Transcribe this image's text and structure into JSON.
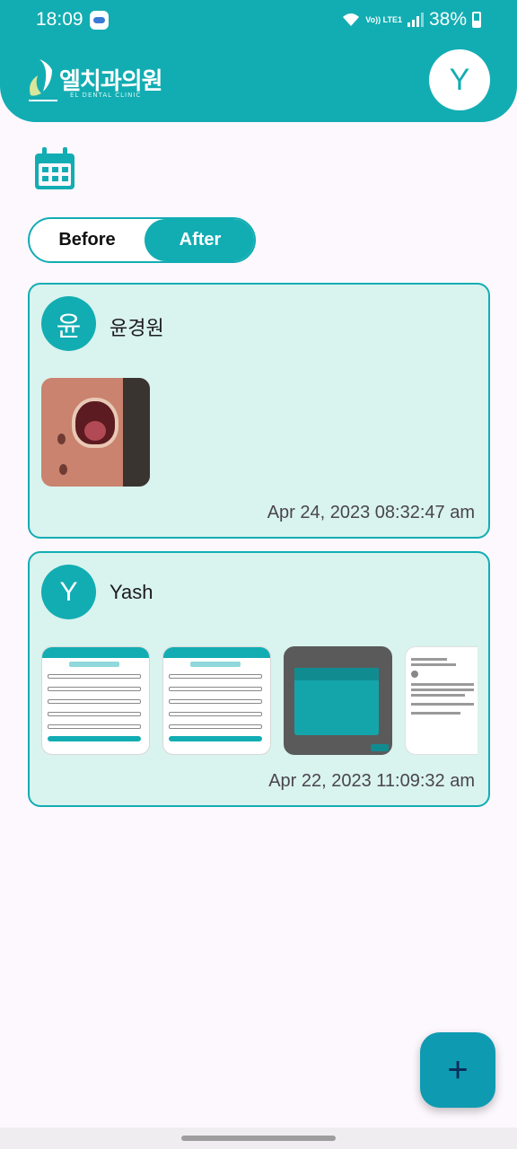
{
  "status_bar": {
    "time": "18:09",
    "network": "Vo)) LTE1",
    "battery": "38%"
  },
  "header": {
    "logo_text": "엘치과의원",
    "logo_subtitle": "EL DENTAL CLINIC",
    "profile_initial": "Y"
  },
  "filter": {
    "before_label": "Before",
    "after_label": "After",
    "selected": "After"
  },
  "cards": [
    {
      "initial": "윤",
      "name": "윤경원",
      "date": "Apr 24, 2023 08:32:47 am",
      "images": [
        "dental-photo"
      ]
    },
    {
      "initial": "Y",
      "name": "Yash",
      "date": "Apr 22, 2023 11:09:32 am",
      "images": [
        "signup-screenshot",
        "signup-screenshot",
        "date-picker-screenshot",
        "sign-in-screenshot"
      ]
    }
  ],
  "fab": {
    "label": "+"
  },
  "colors": {
    "primary": "#12adb3",
    "card_background": "#d9f3ee",
    "fab": "#0e9bb2",
    "background": "#fdf8fd"
  },
  "icons": [
    "calendar-icon",
    "wifi-icon",
    "signal-icon",
    "battery-icon",
    "add-icon"
  ]
}
